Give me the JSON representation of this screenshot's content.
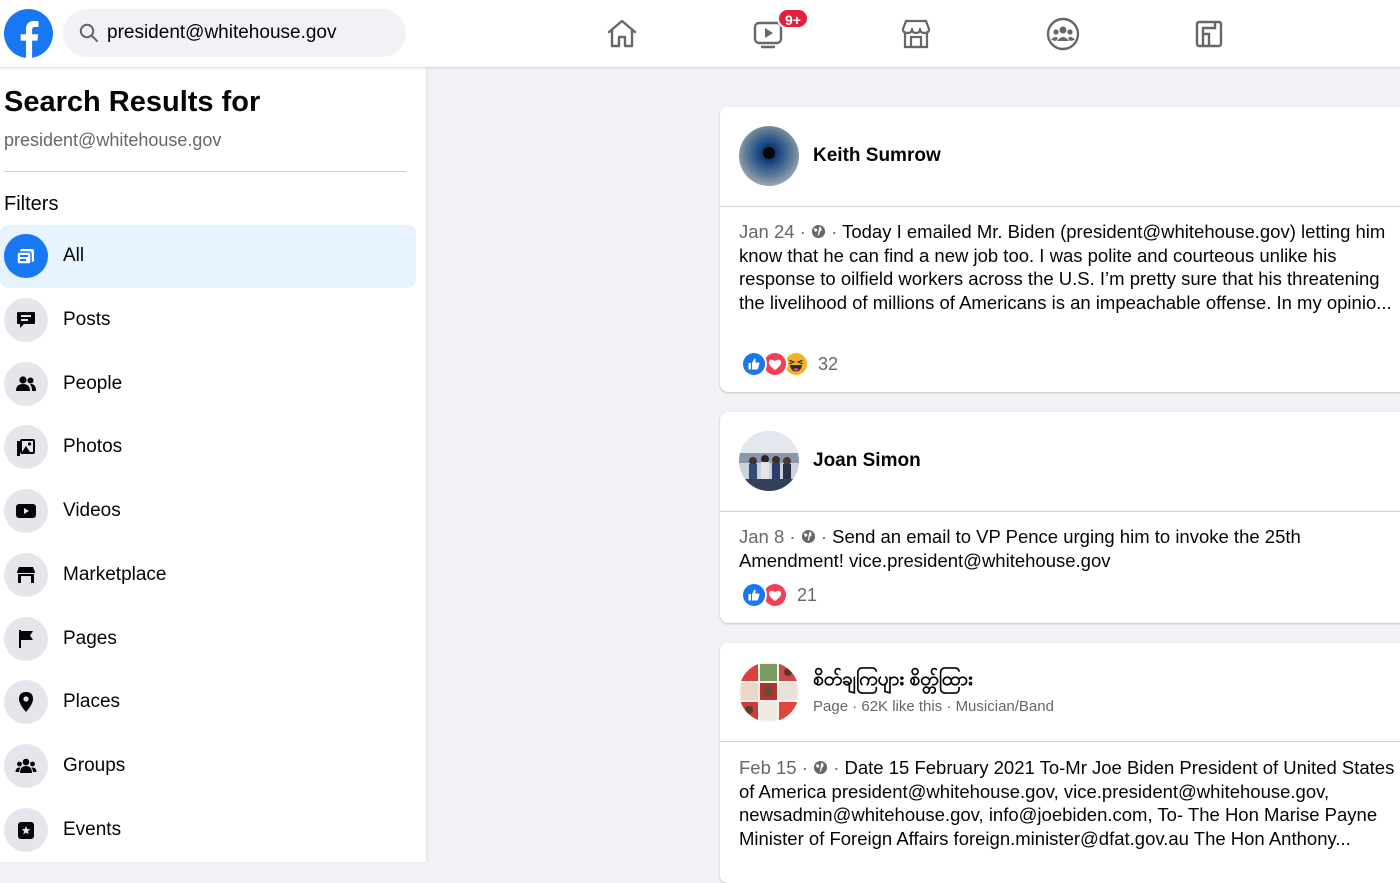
{
  "colors": {
    "brand": "#1877f2",
    "badge": "#e41e3f",
    "secondary_text": "#65676b",
    "page_bg": "#f0f2f5"
  },
  "topbar": {
    "search": {
      "value": "president@whitehouse.gov",
      "icon": "search-icon"
    },
    "nav": [
      {
        "name": "home-icon"
      },
      {
        "name": "watch-icon",
        "badge": "9+"
      },
      {
        "name": "marketplace-icon"
      },
      {
        "name": "groups-icon"
      },
      {
        "name": "gaming-icon"
      }
    ]
  },
  "sidebar": {
    "title": "Search Results for",
    "query": "president@whitehouse.gov",
    "filters_label": "Filters",
    "items": [
      {
        "label": "All",
        "icon": "all-icon",
        "active": true
      },
      {
        "label": "Posts",
        "icon": "posts-icon"
      },
      {
        "label": "People",
        "icon": "people-icon"
      },
      {
        "label": "Photos",
        "icon": "photos-icon"
      },
      {
        "label": "Videos",
        "icon": "videos-icon"
      },
      {
        "label": "Marketplace",
        "icon": "marketplace-icon"
      },
      {
        "label": "Pages",
        "icon": "pages-icon"
      },
      {
        "label": "Places",
        "icon": "places-icon"
      },
      {
        "label": "Groups",
        "icon": "groups-icon"
      },
      {
        "label": "Events",
        "icon": "events-icon"
      }
    ]
  },
  "posts": [
    {
      "author": "Keith Sumrow",
      "date": "Jan 24",
      "text": "Today I emailed Mr. Biden (president@whitehouse.gov) letting him know that he can find a new job too. I was polite and courteous unlike his response to oilfield workers across the U.S. I’m pretty sure that his threatening the livelihood of millions of Americans is an impeachable offense. In my opinio...",
      "reactions": [
        "like",
        "love",
        "haha"
      ],
      "reaction_count": "32"
    },
    {
      "author": "Joan Simon",
      "date": "Jan 8",
      "text": "Send an email to VP Pence urging him to invoke the 25th Amendment! vice.president@whitehouse.gov",
      "reactions": [
        "like",
        "love"
      ],
      "reaction_count": "21"
    },
    {
      "author": "စိတ်ချကြပျား စိတ္တ်ထြား",
      "subtitle": "Page · 62K like this · Musician/Band",
      "date": "Feb 15",
      "text": "Date 15 February 2021 To-Mr Joe Biden President of United States of America president@whitehouse.gov, vice.president@whitehouse.gov, newsadmin@whitehouse.gov, info@joebiden.com, To- The Hon Marise Payne Minister of Foreign Affairs foreign.minister@dfat.gov.au The Hon Anthony..."
    }
  ]
}
